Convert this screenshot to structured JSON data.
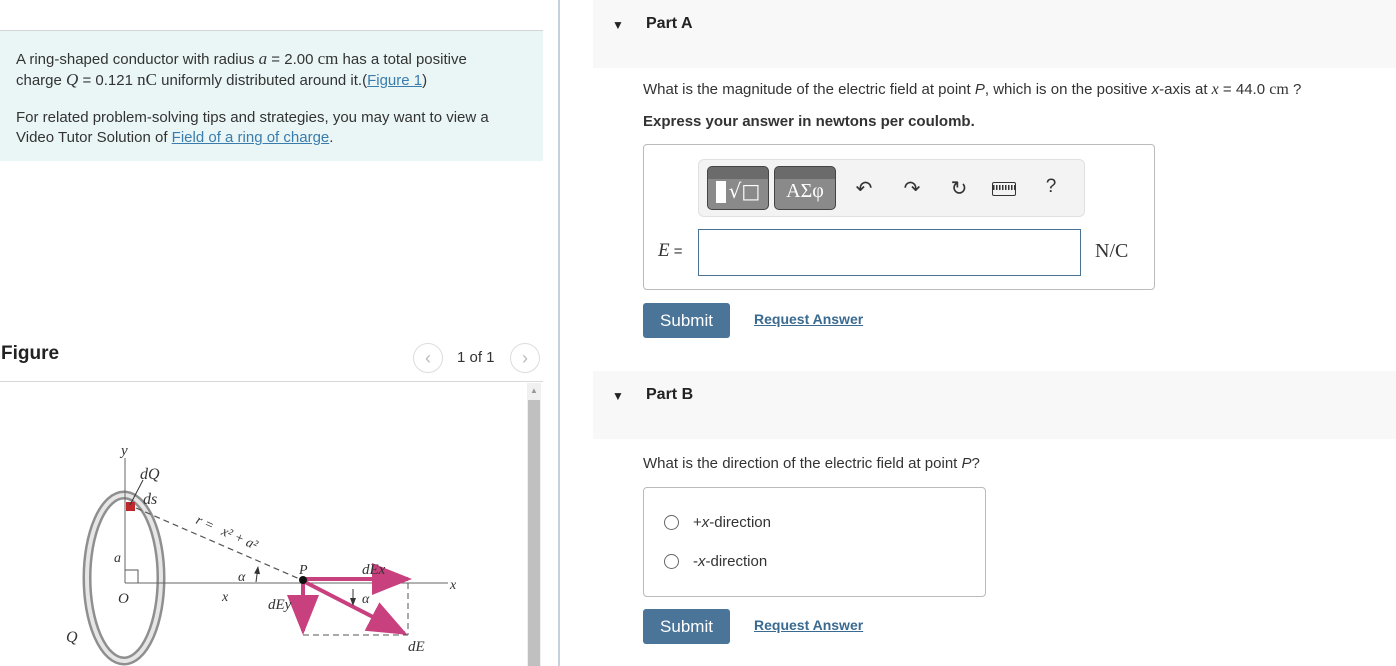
{
  "intro": {
    "line1_pre": "A ring-shaped conductor with radius ",
    "radius_symbol": "a",
    "radius_eq": " = 2.00 ",
    "radius_unit": "cm",
    "line1_post": " has a total positive",
    "line2_pre": "charge ",
    "charge_symbol": "Q",
    "charge_eq": " = 0.121 ",
    "charge_unit": "nC",
    "line2_post": " uniformly distributed around it.(",
    "figure_link": "Figure 1",
    "line2_close": ")",
    "tips_text": "For related problem-solving tips and strategies, you may want to view a Video Tutor Solution of ",
    "tips_link": "Field of a ring of charge",
    "tips_end": "."
  },
  "figure": {
    "title": "Figure",
    "pager": "1 of 1",
    "prev_icon": "chevron-left-icon",
    "next_icon": "chevron-right-icon",
    "labels": {
      "y": "y",
      "dQ": "dQ",
      "ds": "ds",
      "r": "r = ",
      "r_expr": "x² + a²",
      "a": "a",
      "O": "O",
      "Q": "Q",
      "x_dist": "x",
      "alpha1": "α",
      "P": "P",
      "dEx": "dEx",
      "dEy": "dEy",
      "alpha2": "α",
      "dE": "dE",
      "x_axis": "x"
    },
    "colors": {
      "vector": "#c8407e",
      "charge": "#c0272d",
      "ring": "#9a9a9a"
    }
  },
  "partA": {
    "label": "Part A",
    "question_pre": "What is the magnitude of the electric field at point ",
    "point": "P",
    "question_mid": ", which is on the positive ",
    "axis": "x",
    "question_mid2": "-axis at ",
    "x_symbol": "x",
    "x_value": " = 44.0 ",
    "x_unit": "cm",
    "question_end": " ?",
    "instruction": "Express your answer in newtons per coulomb.",
    "toolbar": {
      "template_icon": "templates-icon",
      "greek_label": "ΑΣφ",
      "undo_icon": "undo-icon",
      "redo_icon": "redo-icon",
      "reset_icon": "reset-icon",
      "keyboard_icon": "keyboard-icon",
      "help_label": "?"
    },
    "variable": "E",
    "equals": " =",
    "input_value": "",
    "unit": "N/C",
    "submit_label": "Submit",
    "request_label": "Request Answer"
  },
  "partB": {
    "label": "Part B",
    "question_pre": "What is the direction of the electric field at point ",
    "point": "P",
    "question_end": "?",
    "options": [
      {
        "sign": "+",
        "axis": "x",
        "rest": "-direction"
      },
      {
        "sign": "-",
        "axis": "x",
        "rest": "-direction"
      }
    ],
    "submit_label": "Submit",
    "request_label": "Request Answer"
  },
  "colors": {
    "submit_bg": "#4a7598",
    "link": "#3a7dad",
    "intro_bg": "#eaf6f6",
    "part_header_bg": "#f8f8f8"
  }
}
